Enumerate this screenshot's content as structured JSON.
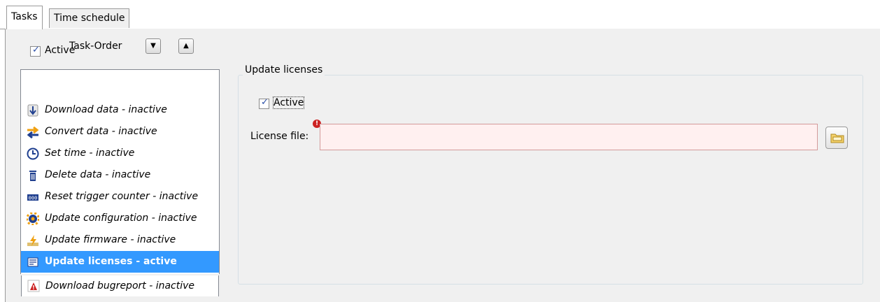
{
  "tabs": [
    {
      "label": "Tasks",
      "selected": true
    },
    {
      "label": "Time schedule",
      "selected": false
    }
  ],
  "top": {
    "active_label": "Active",
    "active_checked": true
  },
  "task_order": {
    "label": "Task-Order",
    "down_icon": "triangle-down-icon",
    "up_icon": "triangle-up-icon"
  },
  "tasks": [
    {
      "label": "Download data - inactive",
      "icon": "download-arrow-icon"
    },
    {
      "label": "Convert data - inactive",
      "icon": "convert-arrows-icon"
    },
    {
      "label": "Set time - inactive",
      "icon": "clock-icon"
    },
    {
      "label": "Delete data - inactive",
      "icon": "trash-icon"
    },
    {
      "label": "Reset trigger counter - inactive",
      "icon": "counter-icon"
    },
    {
      "label": "Update configuration - inactive",
      "icon": "gear-icon"
    },
    {
      "label": "Update firmware - inactive",
      "icon": "firmware-bolt-icon"
    },
    {
      "label": "Update licenses - active",
      "icon": "license-icon",
      "selected": true
    },
    {
      "label": "Download bugreport - inactive",
      "icon": "bugreport-icon"
    }
  ],
  "detail": {
    "group_title": "Update licenses",
    "active_label": "Active",
    "active_checked": true,
    "license_label": "License file:",
    "license_value": "",
    "error_icon": "error-icon",
    "browse_icon": "folder-icon"
  },
  "colors": {
    "selection": "#3399ff",
    "error_field": "#fff0f0"
  }
}
